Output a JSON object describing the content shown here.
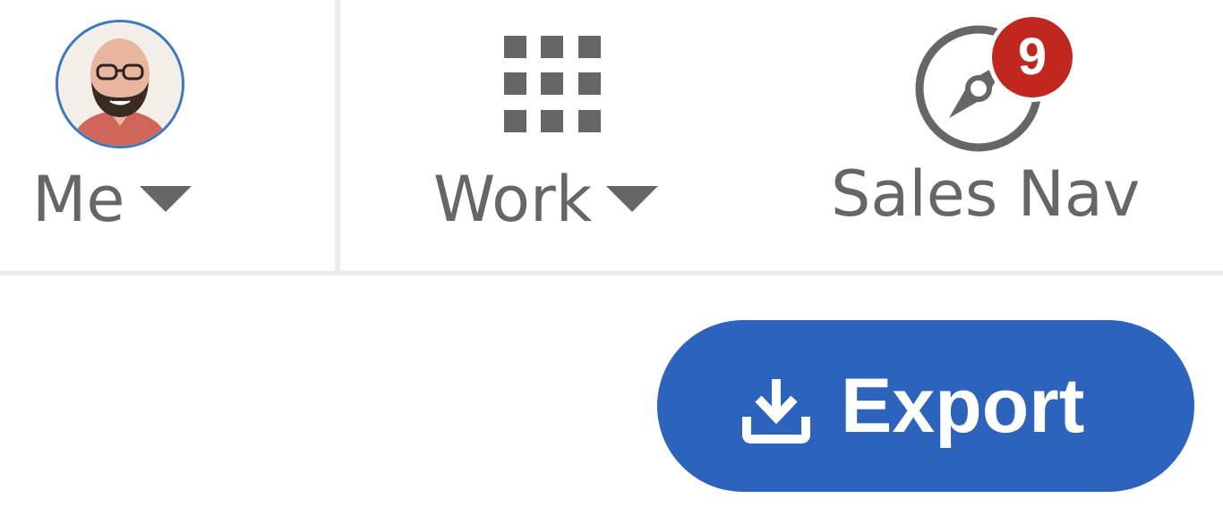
{
  "nav": {
    "me": {
      "label": "Me",
      "icon": "avatar",
      "menu_icon": "caret-down-icon"
    },
    "work": {
      "label": "Work",
      "icon": "apps-grid-icon",
      "menu_icon": "caret-down-icon"
    },
    "sales_nav": {
      "label": "Sales Nav",
      "icon": "compass-icon",
      "badge_count": "9"
    }
  },
  "actions": {
    "export_label": "Export",
    "export_icon": "download-icon"
  },
  "colors": {
    "nav_text": "#666666",
    "badge": "#c0271f",
    "button": "#2c63bd",
    "avatar_ring": "#3b78c3",
    "divider": "#ececec"
  }
}
